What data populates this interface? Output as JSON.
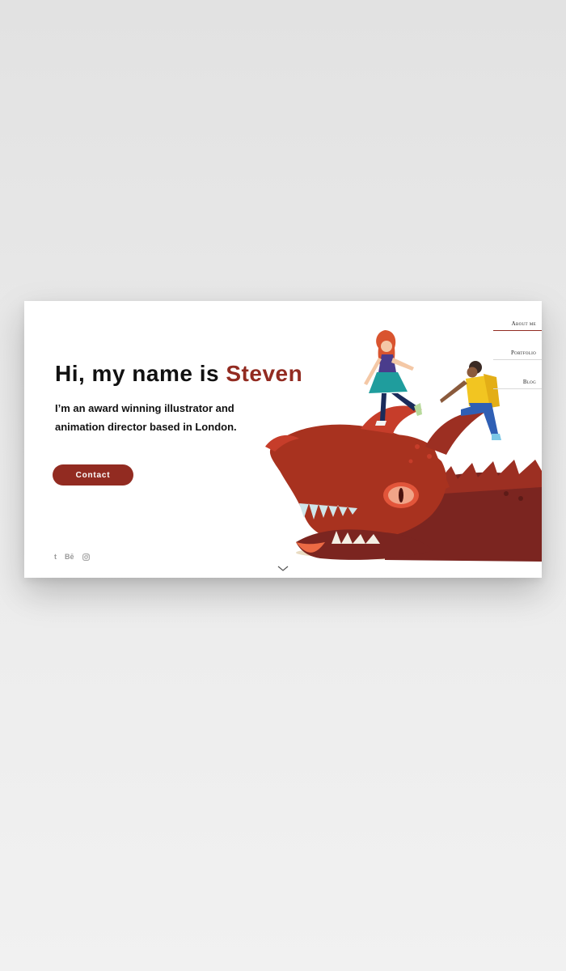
{
  "hero": {
    "headline_prefix": "Hi, my name is ",
    "headline_name": "Steven",
    "intro": "I’m an award winning illustrator and animation director based in London.",
    "contact_label": "Contact"
  },
  "nav": {
    "items": [
      {
        "label": "About me",
        "active": true
      },
      {
        "label": "Portfolio",
        "active": false
      },
      {
        "label": "Blog",
        "active": false
      }
    ]
  },
  "social": {
    "items": [
      {
        "label": "t",
        "icon": "tumblr-icon"
      },
      {
        "label": "Bē",
        "icon": "behance-icon"
      },
      {
        "label": "",
        "icon": "instagram-icon"
      }
    ]
  },
  "colors": {
    "accent": "#922b21",
    "dragon": "#a8321f",
    "girl_skirt": "#1f9d9d",
    "boy_jacket": "#f2c521"
  },
  "icons": {
    "scroll": "chevron-down-icon",
    "illustration": "dragon-with-children-illustration"
  }
}
